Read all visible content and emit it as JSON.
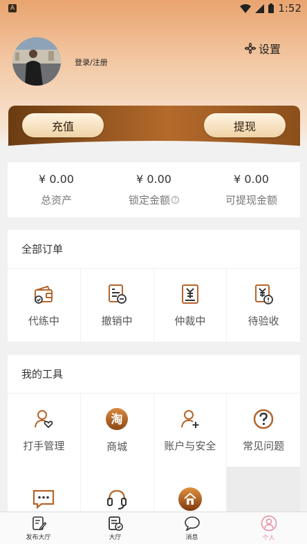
{
  "status_bar": {
    "time": "1:52",
    "notif_icon": "A"
  },
  "profile": {
    "login_text": "登录/注册",
    "settings_label": "设置"
  },
  "wallet": {
    "recharge_label": "充值",
    "withdraw_label": "提现"
  },
  "assets": [
    {
      "value": "¥ 0.00",
      "label": "总资产"
    },
    {
      "value": "¥ 0.00",
      "label": "锁定金额",
      "help": "?"
    },
    {
      "value": "¥ 0.00",
      "label": "可提现金额"
    }
  ],
  "orders": {
    "title": "全部订单",
    "items": [
      {
        "label": "代练中",
        "icon": "wallet-check-icon"
      },
      {
        "label": "撤销中",
        "icon": "document-minus-icon"
      },
      {
        "label": "仲裁中",
        "icon": "yen-document-icon"
      },
      {
        "label": "待验收",
        "icon": "yen-alert-document-icon"
      }
    ]
  },
  "tools": {
    "title": "我的工具",
    "items": [
      {
        "label": "打手管理",
        "icon": "person-heart-icon"
      },
      {
        "label": "商城",
        "icon": "taobao-icon",
        "glyph": "淘"
      },
      {
        "label": "账户与安全",
        "icon": "person-add-icon"
      },
      {
        "label": "常见问题",
        "icon": "question-icon"
      },
      {
        "label": "",
        "icon": "chat-bubble-icon"
      },
      {
        "label": "",
        "icon": "headset-icon"
      },
      {
        "label": "",
        "icon": "house-badge-icon"
      }
    ]
  },
  "bottom_nav": [
    {
      "label": "发布大厅",
      "icon": "edit-document-icon"
    },
    {
      "label": "大厅",
      "icon": "checklist-icon"
    },
    {
      "label": "消息",
      "icon": "chat-icon"
    },
    {
      "label": "个人",
      "icon": "person-icon",
      "active": true
    }
  ],
  "colors": {
    "accent": "#c06a2a",
    "active_tab": "#e58da0",
    "wallet_dark": "#6b3c12"
  }
}
